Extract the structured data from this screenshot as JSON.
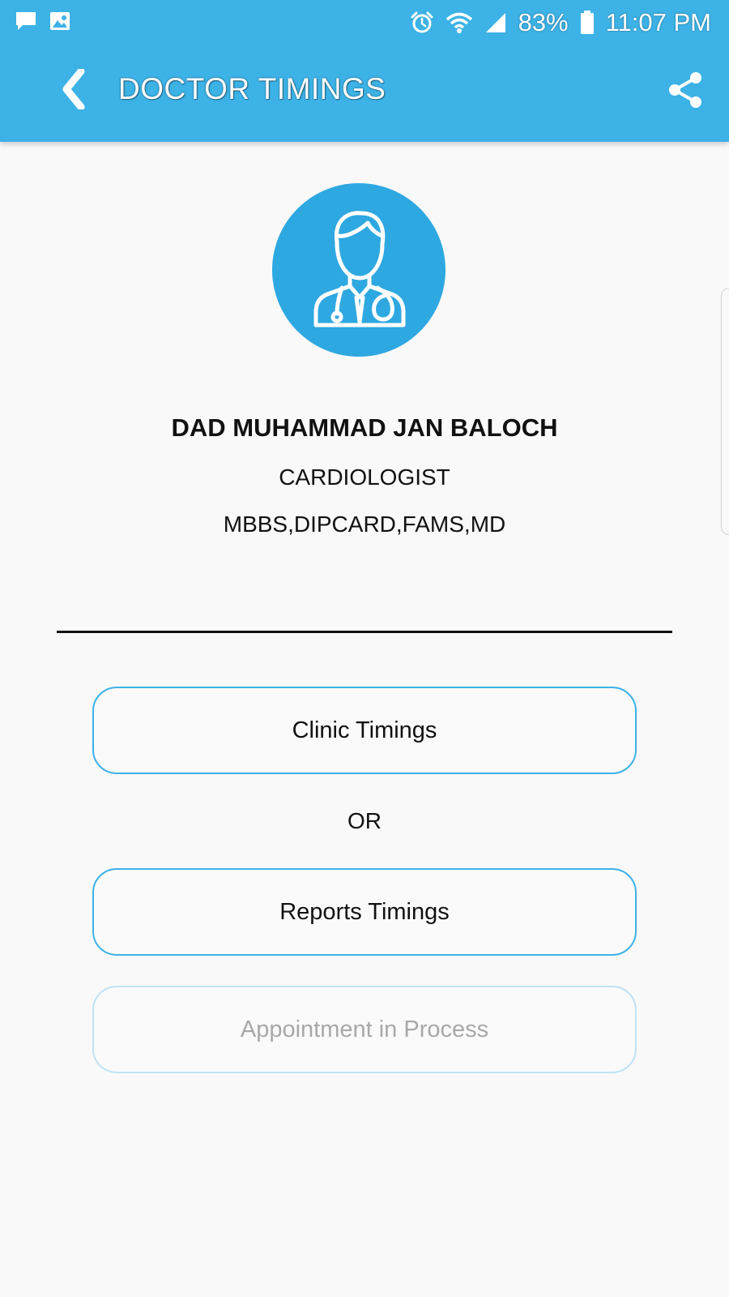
{
  "status_bar": {
    "left_icons": [
      "message-icon",
      "image-icon"
    ],
    "right_icons": [
      "alarm-icon",
      "wifi-icon",
      "signal-icon",
      "battery-icon"
    ],
    "battery_percent": "83%",
    "time": "11:07 PM"
  },
  "app_bar": {
    "title": "DOCTOR TIMINGS",
    "back_icon": "chevron-left-icon",
    "share_icon": "share-icon",
    "background_color": "#3cb2e6"
  },
  "doctor": {
    "avatar_icon": "doctor-avatar-icon",
    "name": "DAD MUHAMMAD JAN BALOCH",
    "specialty": "CARDIOLOGIST",
    "qualifications": "MBBS,DIPCARD,FAMS,MD"
  },
  "actions": {
    "clinic_timings": "Clinic Timings",
    "or_label": "OR",
    "reports_timings": "Reports Timings",
    "appointment_status": "Appointment in Process"
  },
  "colors": {
    "accent": "#3cb2e6",
    "avatar_bg": "#2ea8e1",
    "disabled_border": "#bfe3f5",
    "disabled_text": "#a8a8a8"
  }
}
